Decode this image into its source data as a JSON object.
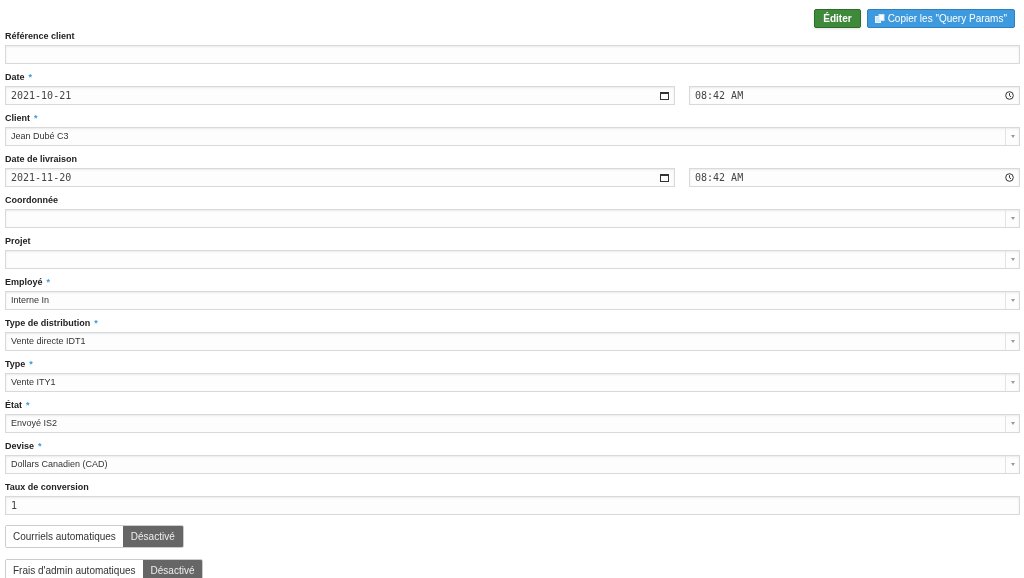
{
  "toolbar": {
    "buttons": [
      {
        "kind": "edit",
        "label": "Éditer"
      },
      {
        "kind": "copy",
        "label": "Copier les \"Query Params\""
      }
    ]
  },
  "fields": [
    {
      "kind": "text",
      "label": "Référence client"
    },
    {
      "kind": "datetime",
      "label": "Date",
      "required_mark": "*",
      "date": "2021-10-21",
      "time": "08:42 AM"
    },
    {
      "kind": "select",
      "label": "Client",
      "required_mark": "*",
      "value": "Jean Dubé C3"
    },
    {
      "kind": "datetime",
      "label": "Date de livraison",
      "date": "2021-11-20",
      "time": "08:42 AM"
    },
    {
      "kind": "select",
      "label": "Coordonnée"
    },
    {
      "kind": "select",
      "label": "Projet"
    },
    {
      "kind": "select",
      "label": "Employé",
      "required_mark": "*",
      "value": "Interne In"
    },
    {
      "kind": "select",
      "label": "Type de distribution",
      "required_mark": "*",
      "value": "Vente directe IDT1"
    },
    {
      "kind": "select",
      "label": "Type",
      "required_mark": "*",
      "value": "Vente ITY1"
    },
    {
      "kind": "select",
      "label": "État",
      "required_mark": "*",
      "value": "Envoyé IS2"
    },
    {
      "kind": "select",
      "label": "Devise",
      "required_mark": "*",
      "value": "Dollars Canadien (CAD)"
    },
    {
      "kind": "text",
      "label": "Taux de conversion",
      "value": "1"
    }
  ],
  "toggles": [
    {
      "label": "Courriels automatiques",
      "state": "Désactivé",
      "on": false
    },
    {
      "label": "Frais d'admin automatiques",
      "state": "Désactivé",
      "on": false
    }
  ]
}
